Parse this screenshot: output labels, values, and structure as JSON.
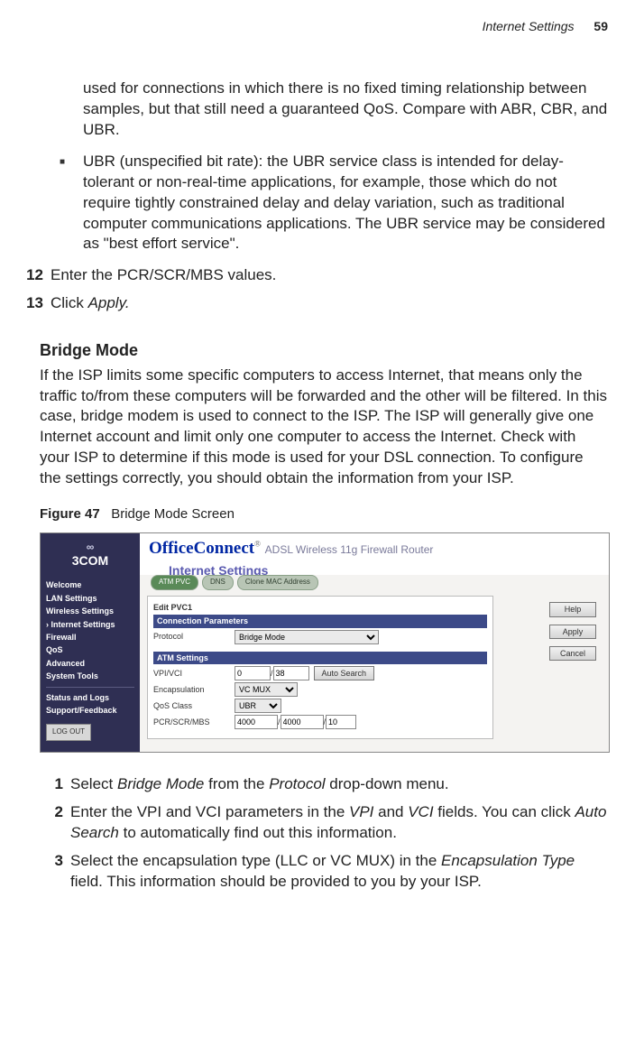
{
  "header": {
    "section": "Internet Settings",
    "page": "59"
  },
  "intro": {
    "para1": "used for connections in which there is no fixed timing relationship between samples, but that still need a guaranteed QoS. Compare with ABR, CBR, and UBR.",
    "bullet_ubr": "UBR (unspecified bit rate): the UBR service class is intended for delay-tolerant or non-real-time applications, for example, those which do not require tightly constrained delay and delay variation, such as traditional computer communications applications. The UBR service may be considered as \"best effort service\"."
  },
  "steps_top": {
    "s12_num": "12",
    "s12_text": "Enter the PCR/SCR/MBS values.",
    "s13_num": "13",
    "s13_pre": "Click ",
    "s13_em": "Apply.",
    "s13_post": ""
  },
  "bridge": {
    "heading": "Bridge Mode",
    "para": "If the ISP limits some specific computers to access Internet, that means only the traffic to/from these computers will be forwarded and the other will be filtered. In this case, bridge modem is used to connect to the ISP. The ISP will generally give one Internet account and limit only one computer to access the Internet. Check with your ISP to determine if this mode is used for your DSL connection. To configure the settings correctly, you should obtain the information from your ISP."
  },
  "figure": {
    "label": "Figure 47",
    "caption": "Bridge Mode Screen"
  },
  "shot": {
    "logo": "3COM",
    "brand": "OfficeConnect",
    "brand_sub": "ADSL Wireless 11g Firewall Router",
    "section_title": "Internet Settings",
    "sidebar": {
      "items": [
        {
          "label": "Welcome"
        },
        {
          "label": "LAN Settings"
        },
        {
          "label": "Wireless Settings"
        },
        {
          "label": "Internet Settings",
          "active": true
        },
        {
          "label": "Firewall"
        },
        {
          "label": "QoS"
        },
        {
          "label": "Advanced"
        },
        {
          "label": "System Tools"
        }
      ],
      "items2": [
        {
          "label": "Status and Logs"
        },
        {
          "label": "Support/Feedback"
        }
      ],
      "logout": "LOG OUT"
    },
    "tabs": {
      "t1": "ATM PVC",
      "t2": "DNS",
      "t3": "Clone MAC Address"
    },
    "panel": {
      "edit_title": "Edit PVC1",
      "bar_conn": "Connection Parameters",
      "protocol_label": "Protocol",
      "protocol_value": "Bridge Mode",
      "bar_atm": "ATM Settings",
      "vpivci_label": "VPI/VCI",
      "vpi": "0",
      "vci": "38",
      "auto_search": "Auto Search",
      "encap_label": "Encapsulation",
      "encap_value": "VC MUX",
      "qos_label": "QoS Class",
      "qos_value": "UBR",
      "pcr_label": "PCR/SCR/MBS",
      "pcr": "4000",
      "scr": "4000",
      "mbs": "10"
    },
    "buttons": {
      "help": "Help",
      "apply": "Apply",
      "cancel": "Cancel"
    }
  },
  "steps_bottom": {
    "s1_num": "1",
    "s1_a": "Select ",
    "s1_b": "Bridge Mode",
    "s1_c": " from the ",
    "s1_d": "Protocol",
    "s1_e": " drop-down menu.",
    "s2_num": "2",
    "s2_a": "Enter the VPI and VCI parameters in the ",
    "s2_b": "VPI",
    "s2_c": " and ",
    "s2_d": "VCI",
    "s2_e": " fields. You can click ",
    "s2_f": "Auto Search",
    "s2_g": " to automatically find out this information.",
    "s3_num": "3",
    "s3_a": "Select the encapsulation type (LLC or VC MUX) in the ",
    "s3_b": "Encapsulation Type",
    "s3_c": " field. This information should be provided to you by your ISP."
  }
}
